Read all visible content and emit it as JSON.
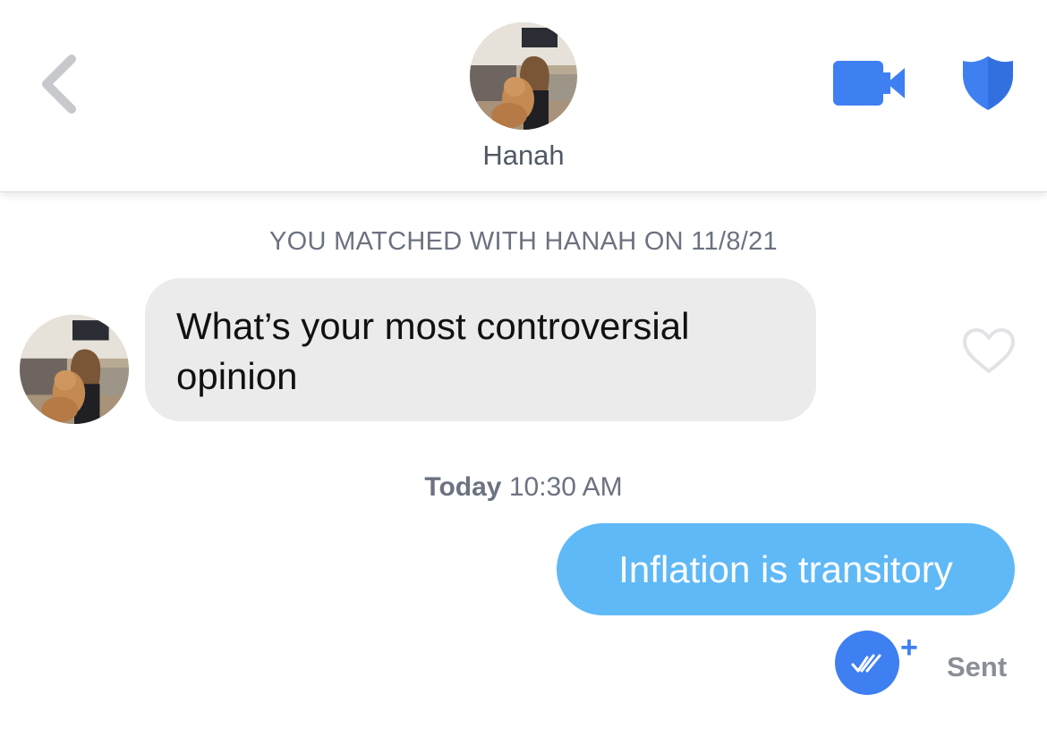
{
  "header": {
    "contact_name": "Hanah",
    "accent_color": "#3e7ff2"
  },
  "icons": {
    "back": "chevron-left-icon",
    "video": "video-camera-icon",
    "safety": "shield-icon",
    "like": "heart-outline-icon",
    "read_receipt": "double-check-icon"
  },
  "conversation": {
    "match_banner": "YOU MATCHED WITH HANAH ON 11/8/21",
    "messages": [
      {
        "direction": "incoming",
        "text": "What’s your most controversial opinion"
      },
      {
        "direction": "outgoing",
        "text": "Inflation is transitory"
      }
    ],
    "timestamp": {
      "day": "Today",
      "time": "10:30 AM"
    },
    "receipt": {
      "plus": "+",
      "status": "Sent"
    }
  },
  "colors": {
    "incoming_bubble": "#ebebeb",
    "outgoing_bubble": "#5fb9f7",
    "secondary_text": "#6b7280"
  }
}
